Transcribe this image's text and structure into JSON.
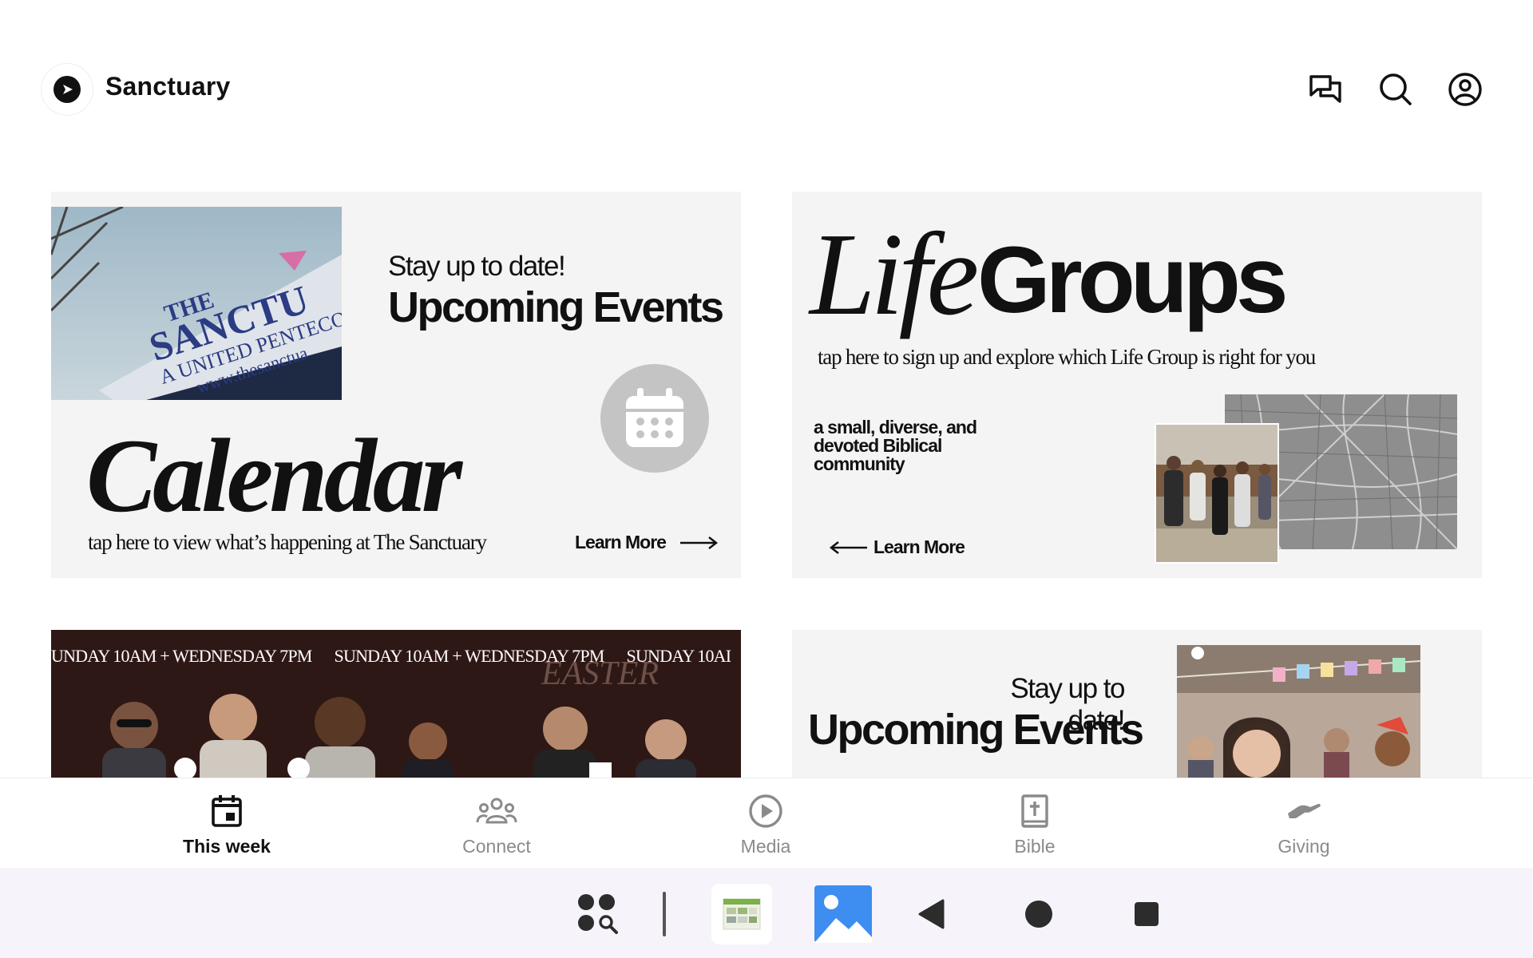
{
  "header": {
    "app_title": "Sanctuary",
    "icons": [
      "chat-icon",
      "search-icon",
      "account-icon"
    ]
  },
  "cards": {
    "calendar": {
      "kicker": "Stay up to date!",
      "headline": "Upcoming Events",
      "big_title": "Calendar",
      "subtitle": "tap here to view what’s happening at The Sanctuary",
      "learn_more": "Learn More",
      "sign_line1": "THE",
      "sign_line2": "SANCTU",
      "sign_line3": "A UNITED PENTECOS",
      "sign_line4": "www.thesanctua"
    },
    "life_groups": {
      "title_script": "Life",
      "title_bold": "Groups",
      "subtitle": "tap here to sign up and explore which Life Group is right for you",
      "desc_lines": [
        "a small, diverse, and",
        "devoted Biblical",
        "community"
      ],
      "learn_more": "Learn More"
    },
    "services": {
      "ticker": [
        "UNDAY 10AM + WEDNESDAY 7PM",
        "SUNDAY 10AM + WEDNESDAY 7PM",
        "SUNDAY 10AI"
      ],
      "backdrop_text": "EASTER"
    },
    "events2": {
      "kicker": "Stay up to date!",
      "headline": "Upcoming Events"
    }
  },
  "bottom_nav": [
    {
      "label": "This week",
      "icon": "calendar-icon",
      "active": true
    },
    {
      "label": "Connect",
      "icon": "people-icon",
      "active": false
    },
    {
      "label": "Media",
      "icon": "play-icon",
      "active": false
    },
    {
      "label": "Bible",
      "icon": "bible-icon",
      "active": false
    },
    {
      "label": "Giving",
      "icon": "giving-hand-icon",
      "active": false
    }
  ],
  "system_bar": [
    "app-search-icon",
    "calendar-app-icon",
    "gallery-app-icon",
    "back-icon",
    "home-icon",
    "recents-icon"
  ],
  "colors": {
    "card_bg": "#f4f4f4",
    "nav_active": "#111111",
    "nav_inactive": "#8a8a8a",
    "gallery_blue": "#3d8ef0"
  }
}
